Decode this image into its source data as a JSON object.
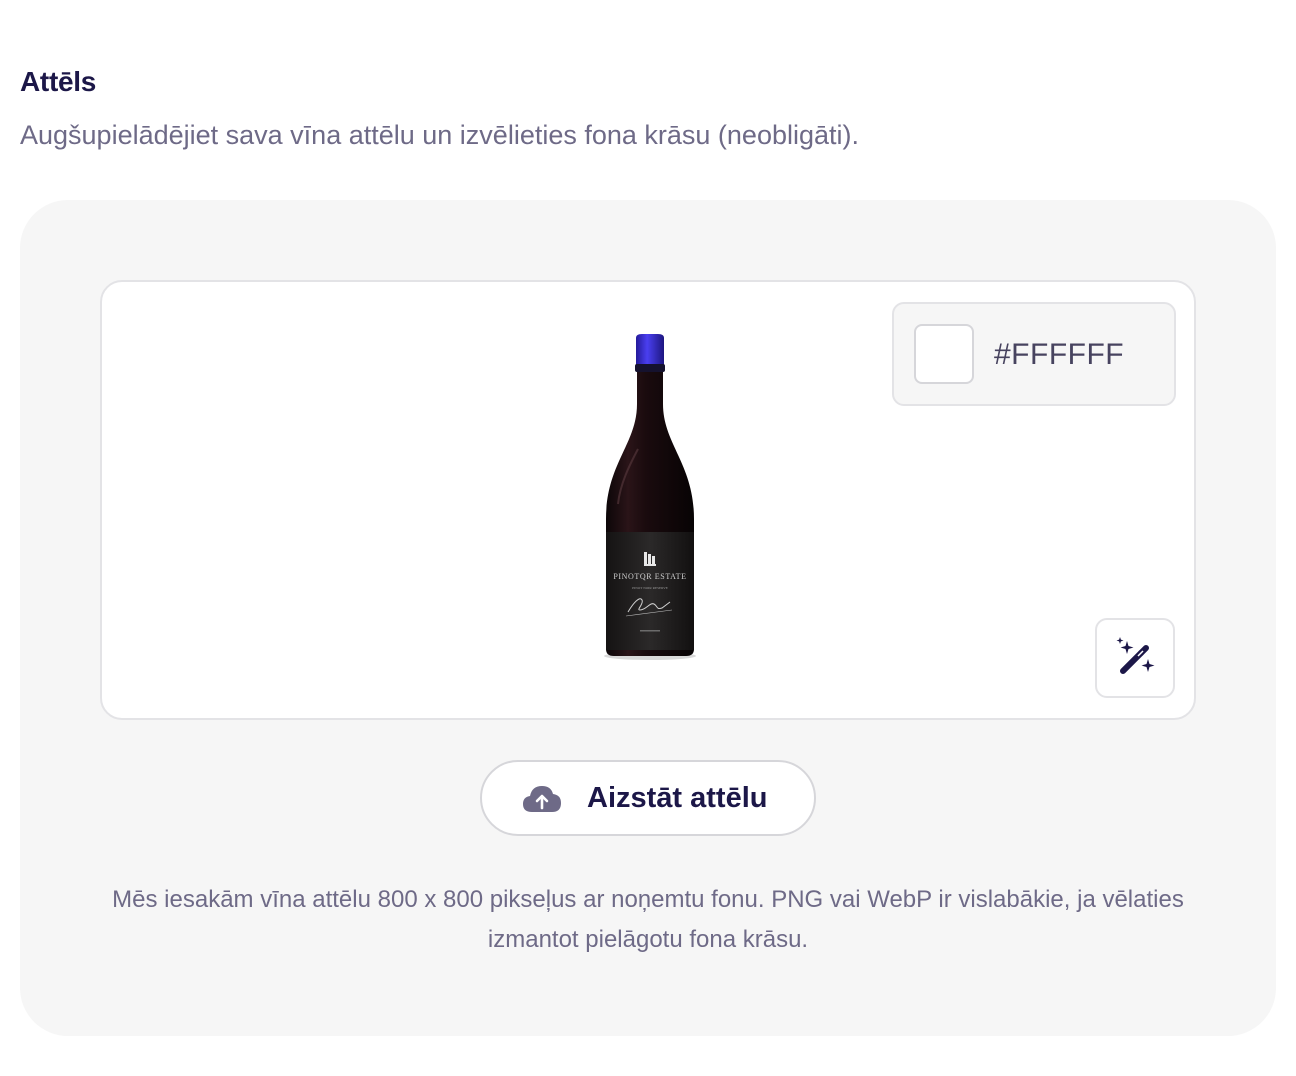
{
  "section": {
    "title": "Attēls",
    "subtitle": "Augšupielādējiet sava vīna attēlu un izvēlieties fona krāsu (neobligāti)."
  },
  "preview": {
    "background_color": "#FFFFFF",
    "bottle_label": {
      "brand": "PINOTQR ESTATE",
      "line": "PINOT NOIR RESERVE"
    }
  },
  "color_picker": {
    "value": "#FFFFFF"
  },
  "icons": {
    "magic": "magic-wand-sparkles-icon",
    "upload": "cloud-upload-icon"
  },
  "replace_button": {
    "label": "Aizstāt attēlu"
  },
  "help_text": "Mēs iesakām vīna attēlu 800 x 800 pikseļus ar noņemtu fonu. PNG vai WebP ir vislabākie, ja vēlaties izmantot pielāgotu fona krāsu.",
  "colors": {
    "heading": "#1c1748",
    "muted_text": "#6e6a87",
    "panel_bg": "#f6f6f6",
    "border": "#e3e3e6",
    "capsule": "#3a2fd0"
  }
}
